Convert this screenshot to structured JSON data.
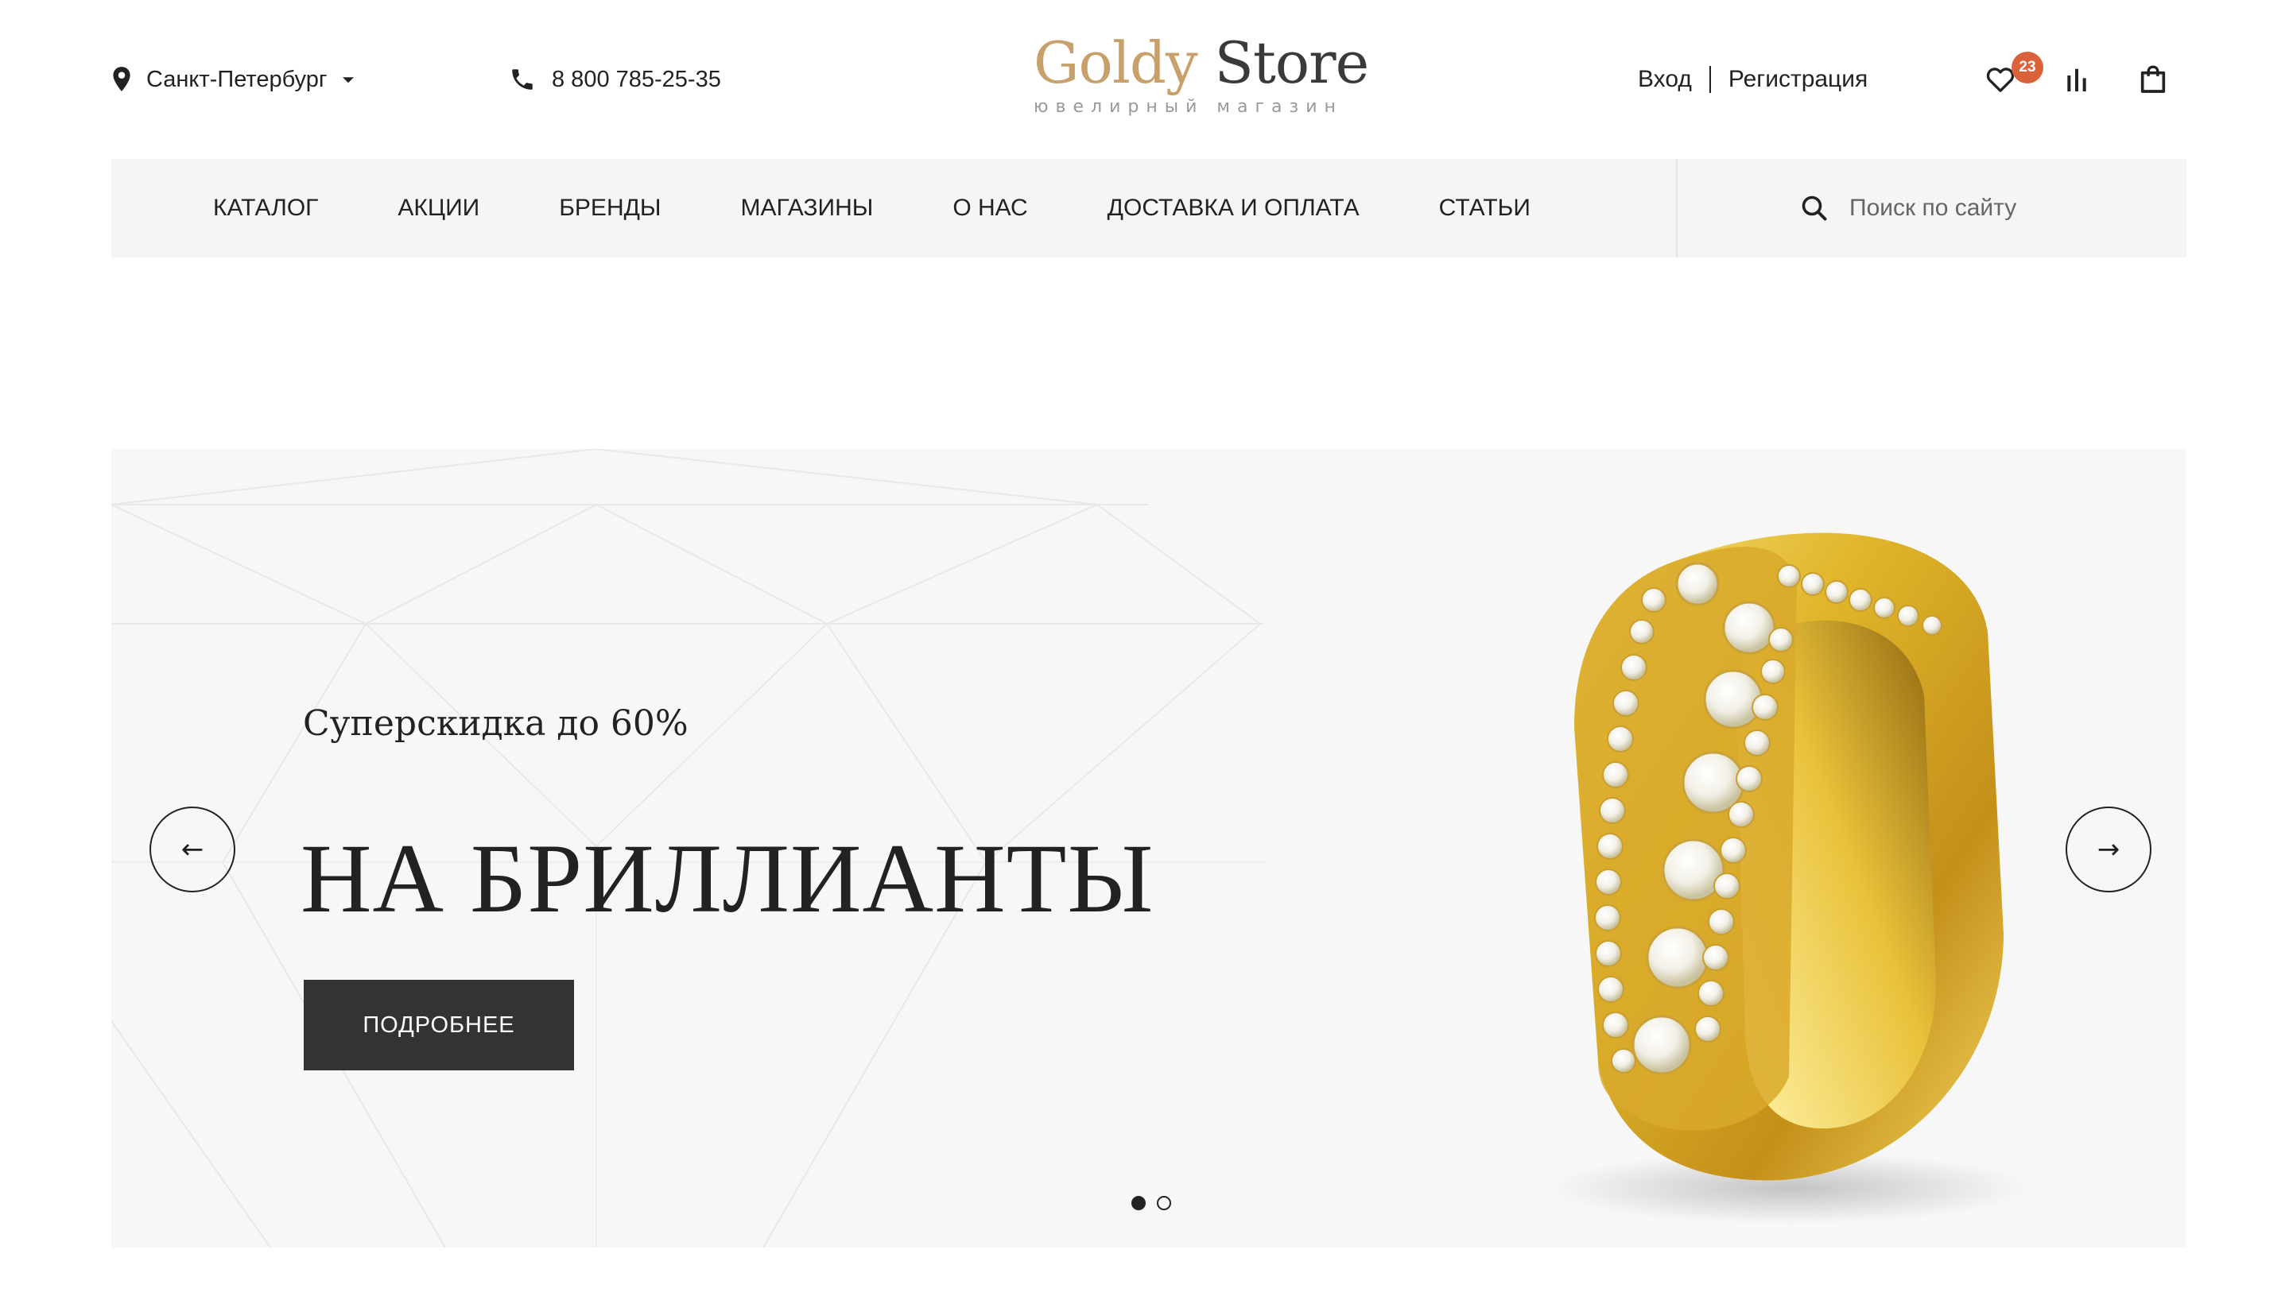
{
  "header": {
    "city": "Санкт-Петербург",
    "phone": "8 800 785-25-35",
    "logo_goldy": "Goldy",
    "logo_store": "Store",
    "logo_tagline": "ювелирный магазин",
    "login": "Вход",
    "register": "Регистрация",
    "favorites_count": "23"
  },
  "nav": {
    "items": [
      {
        "label": "КАТАЛОГ"
      },
      {
        "label": "АКЦИИ"
      },
      {
        "label": "БРЕНДЫ"
      },
      {
        "label": "МАГАЗИНЫ"
      },
      {
        "label": "О НАС"
      },
      {
        "label": "ДОСТАВКА И ОПЛАТА"
      },
      {
        "label": "СТАТЬИ"
      }
    ],
    "search_placeholder": "Поиск по сайту"
  },
  "hero": {
    "subtitle": "Суперскидка до 60%",
    "title": "НА БРИЛЛИАНТЫ",
    "button": "ПОДРОБНЕЕ",
    "prev_arrow": "←",
    "next_arrow": "→",
    "slide_count": 2,
    "active_slide": 1
  },
  "colors": {
    "accent_gold": "#c8a06a",
    "badge": "#d9623a",
    "button_dark": "#333333",
    "nav_bg": "#f5f5f5",
    "hero_bg": "#f7f7f7"
  },
  "icons": [
    "location-pin-icon",
    "chevron-down-icon",
    "phone-icon",
    "heart-icon",
    "compare-bars-icon",
    "shopping-bag-icon",
    "search-icon",
    "arrow-left-icon",
    "arrow-right-icon"
  ]
}
